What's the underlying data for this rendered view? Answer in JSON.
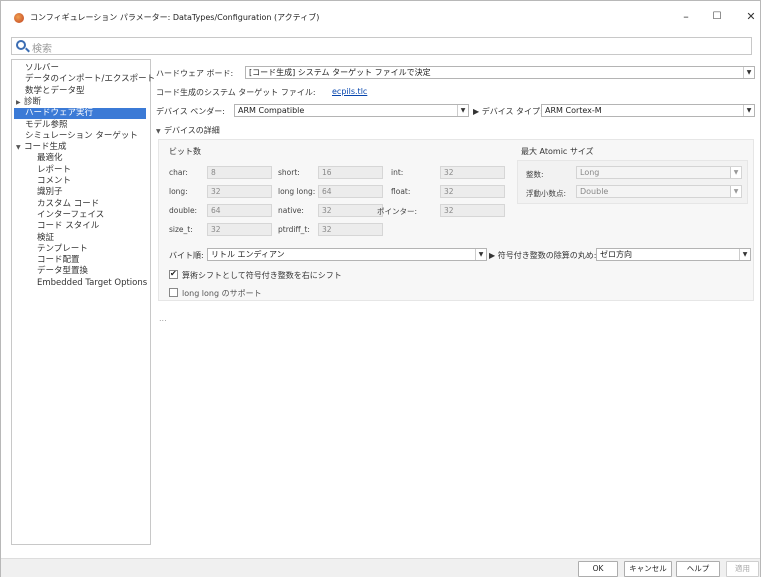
{
  "window": {
    "title": "コンフィギュレーション パラメーター: DataTypes/Configuration (アクティブ)",
    "minimize": "–",
    "maximize": "☐",
    "close": "✕"
  },
  "search": {
    "placeholder": "検索"
  },
  "tree": [
    {
      "label": "ソルバー",
      "indent": 0
    },
    {
      "label": "データのインポート/エクスポート",
      "indent": 0
    },
    {
      "label": "数学とデータ型",
      "indent": 0
    },
    {
      "label": "診断",
      "indent": 0,
      "arrow": "▶"
    },
    {
      "label": "ハードウェア実行",
      "indent": 0,
      "selected": true
    },
    {
      "label": "モデル参照",
      "indent": 0
    },
    {
      "label": "シミュレーション ターゲット",
      "indent": 0
    },
    {
      "label": "コード生成",
      "indent": 0,
      "arrow": "▼"
    },
    {
      "label": "最適化",
      "indent": 1
    },
    {
      "label": "レポート",
      "indent": 1
    },
    {
      "label": "コメント",
      "indent": 1
    },
    {
      "label": "識別子",
      "indent": 1
    },
    {
      "label": "カスタム コード",
      "indent": 1
    },
    {
      "label": "インターフェイス",
      "indent": 1
    },
    {
      "label": "コード スタイル",
      "indent": 1
    },
    {
      "label": "検証",
      "indent": 1
    },
    {
      "label": "テンプレート",
      "indent": 1
    },
    {
      "label": "コード配置",
      "indent": 1
    },
    {
      "label": "データ型置換",
      "indent": 1
    },
    {
      "label": "Embedded Target Options",
      "indent": 1
    }
  ],
  "main": {
    "board_label": "ハードウェア ボード:",
    "board_value": "[コード生成] システム ターゲット ファイルで決定",
    "stf_label": "コード生成のシステム ターゲット ファイル:",
    "stf_link": "ecpils.tlc",
    "vendor_label": "デバイス ベンダー:",
    "vendor_value": "ARM Compatible",
    "type_label": "デバイス タイプ:",
    "type_value": "ARM Cortex-M",
    "details_label": "デバイスの詳細",
    "bits_header": "ビット数",
    "bits": {
      "char": {
        "label": "char:",
        "value": "8"
      },
      "short": {
        "label": "short:",
        "value": "16"
      },
      "int": {
        "label": "int:",
        "value": "32"
      },
      "long": {
        "label": "long:",
        "value": "32"
      },
      "longlong": {
        "label": "long long:",
        "value": "64"
      },
      "float": {
        "label": "float:",
        "value": "32"
      },
      "double": {
        "label": "double:",
        "value": "64"
      },
      "native": {
        "label": "native:",
        "value": "32"
      },
      "pointer": {
        "label": "ポインター:",
        "value": "32"
      },
      "size_t": {
        "label": "size_t:",
        "value": "32"
      },
      "ptrdiff_t": {
        "label": "ptrdiff_t:",
        "value": "32"
      }
    },
    "atomic_header": "最大 Atomic サイズ",
    "atomic_int_label": "整数:",
    "atomic_int_value": "Long",
    "atomic_float_label": "浮動小数点:",
    "atomic_float_value": "Double",
    "byte_order_label": "バイト順:",
    "byte_order_value": "リトル エンディアン",
    "rounding_label": "符号付き整数の除算の丸め:",
    "rounding_value": "ゼロ方向",
    "shift_label": "算術シフトとして符号付き整数を右にシフト",
    "longlong_label": "long long のサポート",
    "ellipsis": "..."
  },
  "buttons": {
    "ok": "OK",
    "cancel": "キャンセル",
    "help": "ヘルプ",
    "apply": "適用"
  }
}
